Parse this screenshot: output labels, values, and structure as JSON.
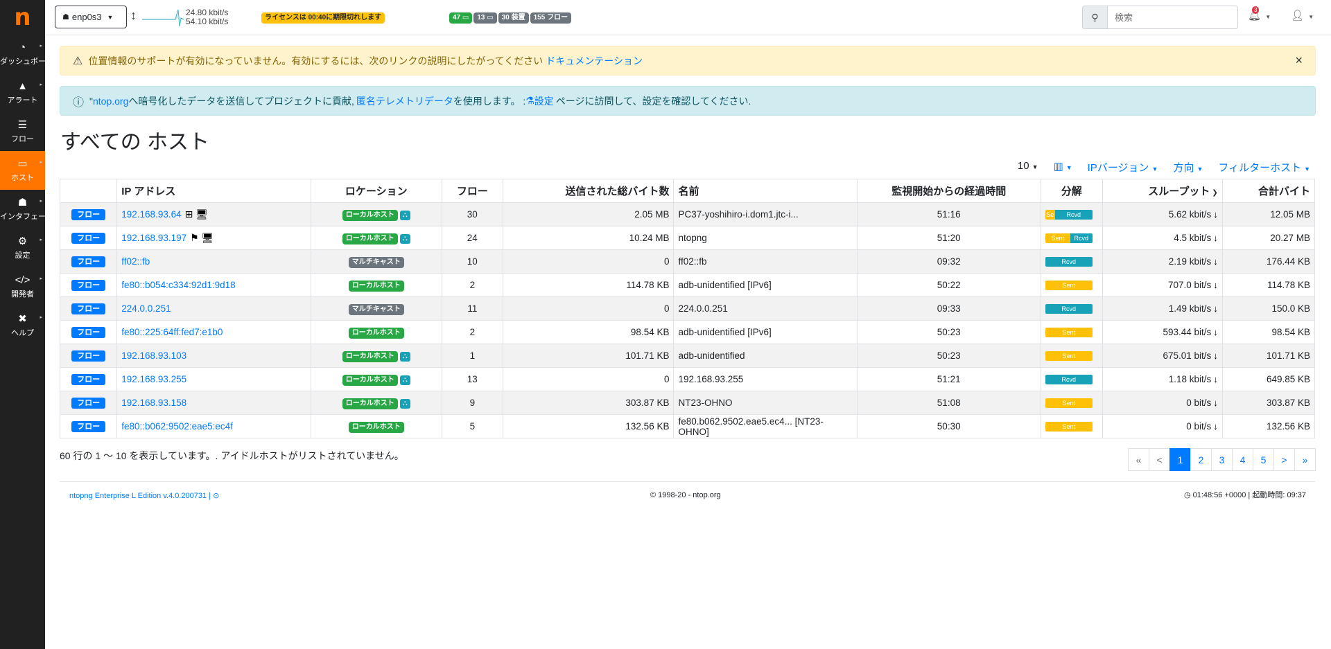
{
  "sidebar": {
    "logo": "n",
    "items": [
      {
        "label": "ダッシュボード",
        "icon": "◔"
      },
      {
        "label": "アラート",
        "icon": "▲"
      },
      {
        "label": "フロー",
        "icon": "☰"
      },
      {
        "label": "ホスト",
        "icon": "▭"
      },
      {
        "label": "インタフェース",
        "icon": "☗"
      },
      {
        "label": "設定",
        "icon": "⚙"
      },
      {
        "label": "開発者",
        "icon": "</>"
      },
      {
        "label": "ヘルプ",
        "icon": "✖"
      }
    ]
  },
  "topbar": {
    "interface": "enp0s3",
    "traffic_up": "24.80 kbit/s",
    "traffic_down": "54.10 kbit/s",
    "license": "ライセンスは 00:40に期限切れします",
    "badge_alerts": "47",
    "badge_hosts": "13",
    "badge_devices": "30 装置",
    "badge_flows": "155 フロー",
    "search_placeholder": "検索",
    "notif_count": "3"
  },
  "alerts": {
    "warning_text": "位置情報のサポートが有効になっていません。有効にするには、次のリンクの説明にしたがってください",
    "warning_link": "ドキュメンテーション",
    "info_prefix": "\"",
    "info_link1": "ntop.org",
    "info_mid": "へ暗号化したデータを送信してプロジェクトに貢献,",
    "info_link2": "匿名テレメトリデータ",
    "info_mid2": "を使用します。 :",
    "info_link3": "設定",
    "info_suffix": "ページに訪問して、設定を確認してください."
  },
  "page_title": "すべての ホスト",
  "tools": {
    "rows": "10",
    "ip_version": "IPバージョン",
    "direction": "方向",
    "filter": "フィルターホスト"
  },
  "table": {
    "headers": [
      "",
      "IP アドレス",
      "ロケーション",
      "フロー",
      "送信された総バイト数",
      "名前",
      "監視開始からの経過時間",
      "分解",
      "スループット",
      "合計バイト"
    ],
    "flow_label": "フロー",
    "rows": [
      {
        "ip": "192.168.93.64",
        "icons": "⊞ 🖥",
        "loc": "ローカルホスト",
        "loc_type": "local",
        "net": true,
        "flows": "30",
        "sent": "2.05 MB",
        "name": "PC37-yoshihiro-i.dom1.jtc-i...",
        "age": "51:16",
        "s": "Se",
        "r": "Rcvd",
        "sw": 14,
        "thr": "5.62 kbit/s",
        "total": "12.05 MB"
      },
      {
        "ip": "192.168.93.197",
        "icons": "⚑ 🖥",
        "loc": "ローカルホスト",
        "loc_type": "local",
        "net": true,
        "flows": "24",
        "sent": "10.24 MB",
        "name": "ntopng",
        "age": "51:20",
        "s": "Sent",
        "r": "Rcvd",
        "sw": 36,
        "thr": "4.5 kbit/s",
        "total": "20.27 MB"
      },
      {
        "ip": "ff02::fb",
        "icons": "",
        "loc": "マルチキャスト",
        "loc_type": "mc",
        "net": false,
        "flows": "10",
        "sent": "0",
        "name": "ff02::fb",
        "age": "09:32",
        "s": "",
        "r": "Rcvd",
        "sw": 0,
        "thr": "2.19 kbit/s",
        "total": "176.44 KB"
      },
      {
        "ip": "fe80::b054:c334:92d1:9d18",
        "icons": "",
        "loc": "ローカルホスト",
        "loc_type": "local",
        "net": false,
        "flows": "2",
        "sent": "114.78 KB",
        "name": "adb-unidentified [IPv6]",
        "age": "50:22",
        "s": "Sent",
        "r": "",
        "sw": 68,
        "thr": "707.0 bit/s",
        "total": "114.78 KB"
      },
      {
        "ip": "224.0.0.251",
        "icons": "",
        "loc": "マルチキャスト",
        "loc_type": "mc",
        "net": false,
        "flows": "11",
        "sent": "0",
        "name": "224.0.0.251",
        "age": "09:33",
        "s": "",
        "r": "Rcvd",
        "sw": 0,
        "thr": "1.49 kbit/s",
        "total": "150.0 KB"
      },
      {
        "ip": "fe80::225:64ff:fed7:e1b0",
        "icons": "",
        "loc": "ローカルホスト",
        "loc_type": "local",
        "net": false,
        "flows": "2",
        "sent": "98.54 KB",
        "name": "adb-unidentified [IPv6]",
        "age": "50:23",
        "s": "Sent",
        "r": "",
        "sw": 68,
        "thr": "593.44 bit/s",
        "total": "98.54 KB"
      },
      {
        "ip": "192.168.93.103",
        "icons": "",
        "loc": "ローカルホスト",
        "loc_type": "local",
        "net": true,
        "flows": "1",
        "sent": "101.71 KB",
        "name": "adb-unidentified",
        "age": "50:23",
        "s": "Sent",
        "r": "",
        "sw": 68,
        "thr": "675.01 bit/s",
        "total": "101.71 KB"
      },
      {
        "ip": "192.168.93.255",
        "icons": "",
        "loc": "ローカルホスト",
        "loc_type": "local",
        "net": true,
        "flows": "13",
        "sent": "0",
        "name": "192.168.93.255",
        "age": "51:21",
        "s": "",
        "r": "Rcvd",
        "sw": 0,
        "thr": "1.18 kbit/s",
        "total": "649.85 KB"
      },
      {
        "ip": "192.168.93.158",
        "icons": "",
        "loc": "ローカルホスト",
        "loc_type": "local",
        "net": true,
        "flows": "9",
        "sent": "303.87 KB",
        "name": "NT23-OHNO",
        "age": "51:08",
        "s": "Sent",
        "r": "",
        "sw": 68,
        "thr": "0 bit/s",
        "total": "303.87 KB"
      },
      {
        "ip": "fe80::b062:9502:eae5:ec4f",
        "icons": "",
        "loc": "ローカルホスト",
        "loc_type": "local",
        "net": false,
        "flows": "5",
        "sent": "132.56 KB",
        "name": "fe80.b062.9502.eae5.ec4... [NT23-OHNO]",
        "age": "50:30",
        "s": "Sent",
        "r": "",
        "sw": 68,
        "thr": "0 bit/s",
        "total": "132.56 KB"
      }
    ]
  },
  "summary": "60 行の 1 ～ 10 を表示しています。. アイドルホストがリストされていません。",
  "pager": [
    "«",
    "<",
    "1",
    "2",
    "3",
    "4",
    "5",
    ">",
    "»"
  ],
  "footer": {
    "left": "ntopng Enterprise L Edition v.4.0.200731 |",
    "mid": "© 1998-20 - ntop.org",
    "right": "01:48:56 +0000 | 起動時間: 09:37"
  },
  "colors": {
    "accent": "#ff7500",
    "primary": "#007bff",
    "success": "#28a745",
    "info": "#17a2b8",
    "warning": "#ffc107"
  }
}
